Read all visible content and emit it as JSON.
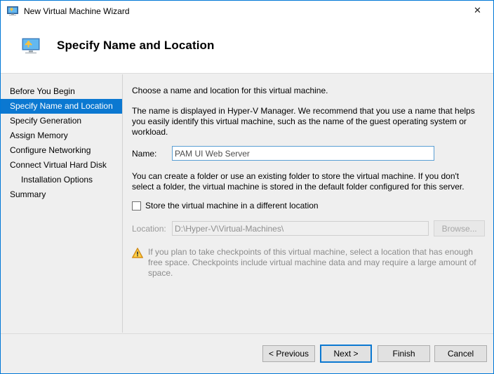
{
  "window": {
    "title": "New Virtual Machine Wizard",
    "titlebar_icon": "virtual-machine-icon",
    "close_label": "✕",
    "border_color": "#0078d7"
  },
  "header": {
    "title": "Specify Name and Location",
    "icon": "virtual-machine-icon"
  },
  "sidebar": {
    "accent_color": "#0b78d1",
    "items": [
      {
        "label": "Before You Begin",
        "selected": false,
        "indent": false
      },
      {
        "label": "Specify Name and Location",
        "selected": true,
        "indent": false
      },
      {
        "label": "Specify Generation",
        "selected": false,
        "indent": false
      },
      {
        "label": "Assign Memory",
        "selected": false,
        "indent": false
      },
      {
        "label": "Configure Networking",
        "selected": false,
        "indent": false
      },
      {
        "label": "Connect Virtual Hard Disk",
        "selected": false,
        "indent": false
      },
      {
        "label": "Installation Options",
        "selected": false,
        "indent": true
      },
      {
        "label": "Summary",
        "selected": false,
        "indent": false
      }
    ]
  },
  "content": {
    "intro": "Choose a name and location for this virtual machine.",
    "description": "The name is displayed in Hyper-V Manager. We recommend that you use a name that helps you easily identify this virtual machine, such as the name of the guest operating system or workload.",
    "name_label": "Name:",
    "name_value": "PAM UI Web Server",
    "name_placeholder": "",
    "folder_description": "You can create a folder or use an existing folder to store the virtual machine. If you don't select a folder, the virtual machine is stored in the default folder configured for this server.",
    "store_checkbox_label": "Store the virtual machine in a different location",
    "store_checkbox_checked": false,
    "location_label": "Location:",
    "location_value": "D:\\Hyper-V\\Virtual-Machines\\",
    "location_disabled": true,
    "browse_label": "Browse...",
    "browse_disabled": true,
    "warning_icon": "warning-triangle-icon",
    "warning_text": "If you plan to take checkpoints of this virtual machine, select a location that has enough free space. Checkpoints include virtual machine data and may require a large amount of space.",
    "warning_color": "#8c8c8c"
  },
  "footer": {
    "previous_label": "< Previous",
    "next_label": "Next >",
    "finish_label": "Finish",
    "cancel_label": "Cancel",
    "default_button": "Next >"
  }
}
